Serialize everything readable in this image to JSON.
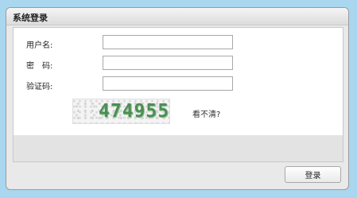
{
  "dialog": {
    "title": "系统登录"
  },
  "form": {
    "username_label": "用户名:",
    "password_label": "密　码:",
    "captcha_label": "验证码:",
    "username_value": "",
    "password_value": "",
    "captcha_value": ""
  },
  "captcha": {
    "code": "474955",
    "refresh_text": "看不清?"
  },
  "buttons": {
    "login": "登录"
  }
}
